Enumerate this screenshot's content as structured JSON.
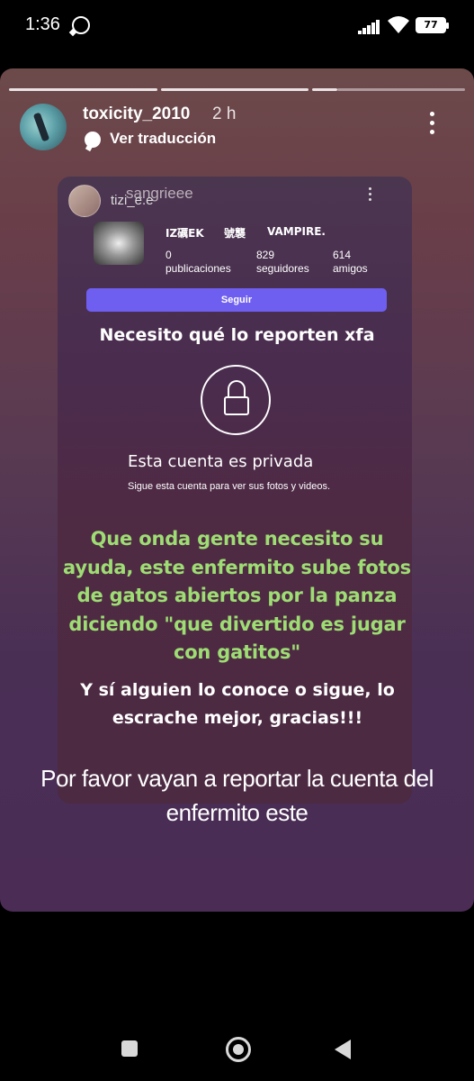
{
  "status_bar": {
    "time": "1:36",
    "battery": "77"
  },
  "story": {
    "username": "toxicity_2010",
    "time_ago": "2 h",
    "translate_label": "Ver traducción",
    "progress_segments": 4,
    "current_segment": 3
  },
  "embedded": {
    "account_name_overlay": "tizi_e.e",
    "account_name": "sangrieee",
    "tags": [
      "IZ礪EK",
      "號襲",
      "VAMPIRE."
    ],
    "stats": [
      {
        "value": "0",
        "label": "publicaciones"
      },
      {
        "value": "829",
        "label": "seguidores"
      },
      {
        "value": "614",
        "label": "amigos"
      }
    ],
    "follow_button": "Seguir",
    "report_request": "Necesito qué lo reporten xfa",
    "private_title": "Esta cuenta es privada",
    "private_subtitle": "Sigue esta cuenta para ver sus fotos y videos."
  },
  "overlay_text": {
    "green": "Que onda gente necesito su ayuda, este enfermito sube fotos de gatos abiertos por la panza diciendo \"que divertido es jugar con gatitos\"",
    "white": "Y sí alguien lo conoce o sigue, lo escrache mejor, gracias!!!",
    "caption": "Por favor vayan a reportar la cuenta del enfermito este"
  },
  "colors": {
    "green_text": "#9edd74",
    "follow_button": "#6f5ff0"
  }
}
